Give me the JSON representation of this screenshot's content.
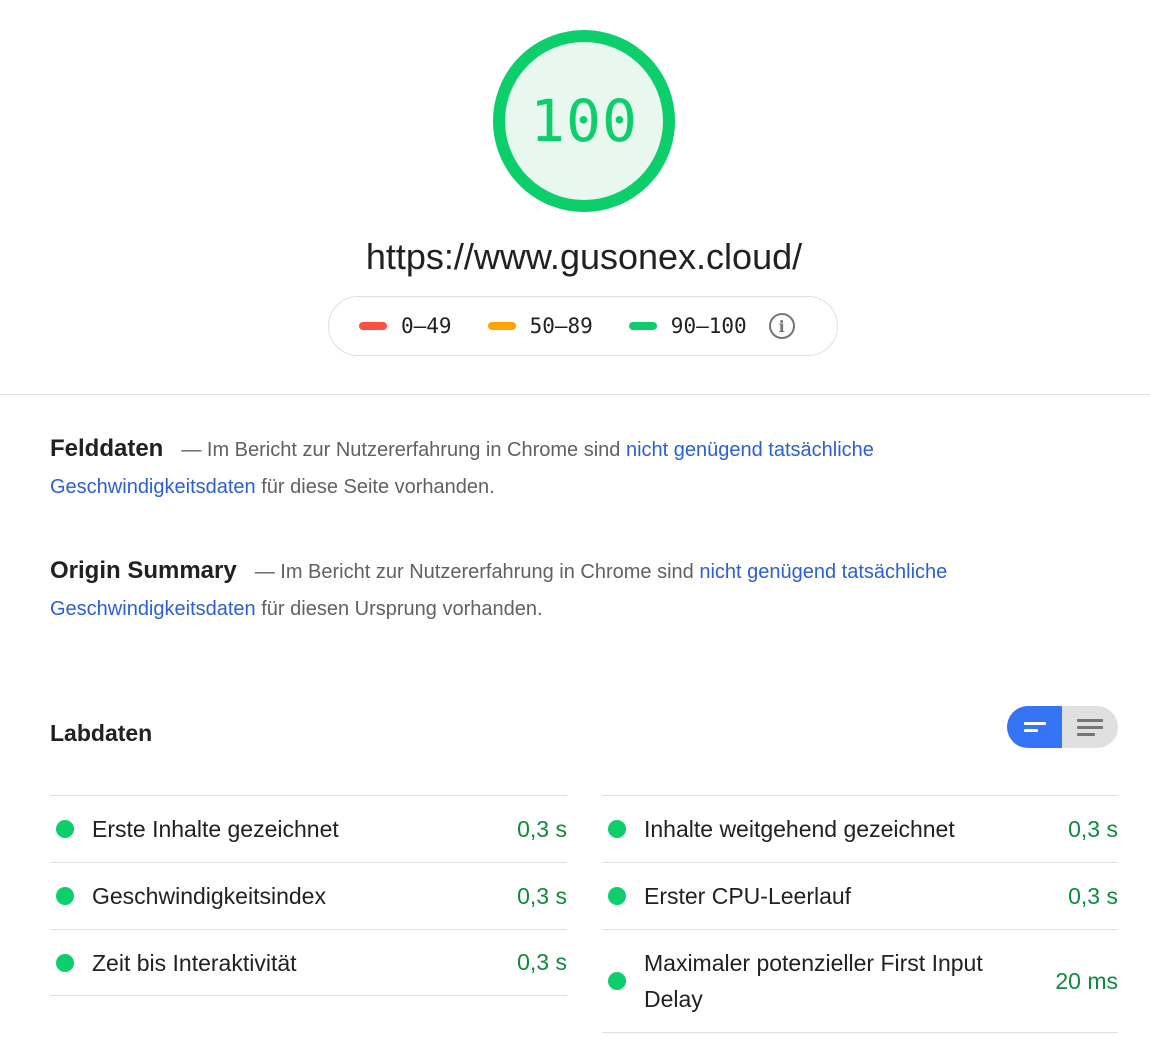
{
  "score": {
    "value": "100",
    "color": "#0cce6b"
  },
  "url": "https://www.gusonex.cloud/",
  "legend": [
    {
      "label": "0–49",
      "color": "#ff4e42"
    },
    {
      "label": "50–89",
      "color": "#ffa400"
    },
    {
      "label": "90–100",
      "color": "#0cce6b"
    }
  ],
  "field_data": {
    "heading": "Felddaten",
    "text_before": "— Im Bericht zur Nutzererfahrung in Chrome sind ",
    "link": "nicht genügend tatsächliche Geschwindigkeitsdaten",
    "text_after": " für diese Seite vorhanden."
  },
  "origin_summary": {
    "heading": "Origin Summary",
    "text_before": "— Im Bericht zur Nutzererfahrung in Chrome sind ",
    "link": "nicht genügend tatsächliche Geschwindigkeitsdaten",
    "text_after": " für diesen Ursprung vorhanden."
  },
  "lab_data": {
    "heading": "Labdaten",
    "left": [
      {
        "name": "Erste Inhalte gezeichnet",
        "value": "0,3 s"
      },
      {
        "name": "Geschwindigkeitsindex",
        "value": "0,3 s"
      },
      {
        "name": "Zeit bis Interaktivität",
        "value": "0,3 s"
      }
    ],
    "right": [
      {
        "name": "Inhalte weitgehend gezeichnet",
        "value": "0,3 s"
      },
      {
        "name": "Erster CPU-Leerlauf",
        "value": "0,3 s"
      },
      {
        "name": "Maximaler potenzieller First Input Delay",
        "value": "20 ms"
      }
    ]
  },
  "colors": {
    "link": "#2a5fd6",
    "pass": "#0cce6b",
    "toggle_active": "#3574f5"
  }
}
